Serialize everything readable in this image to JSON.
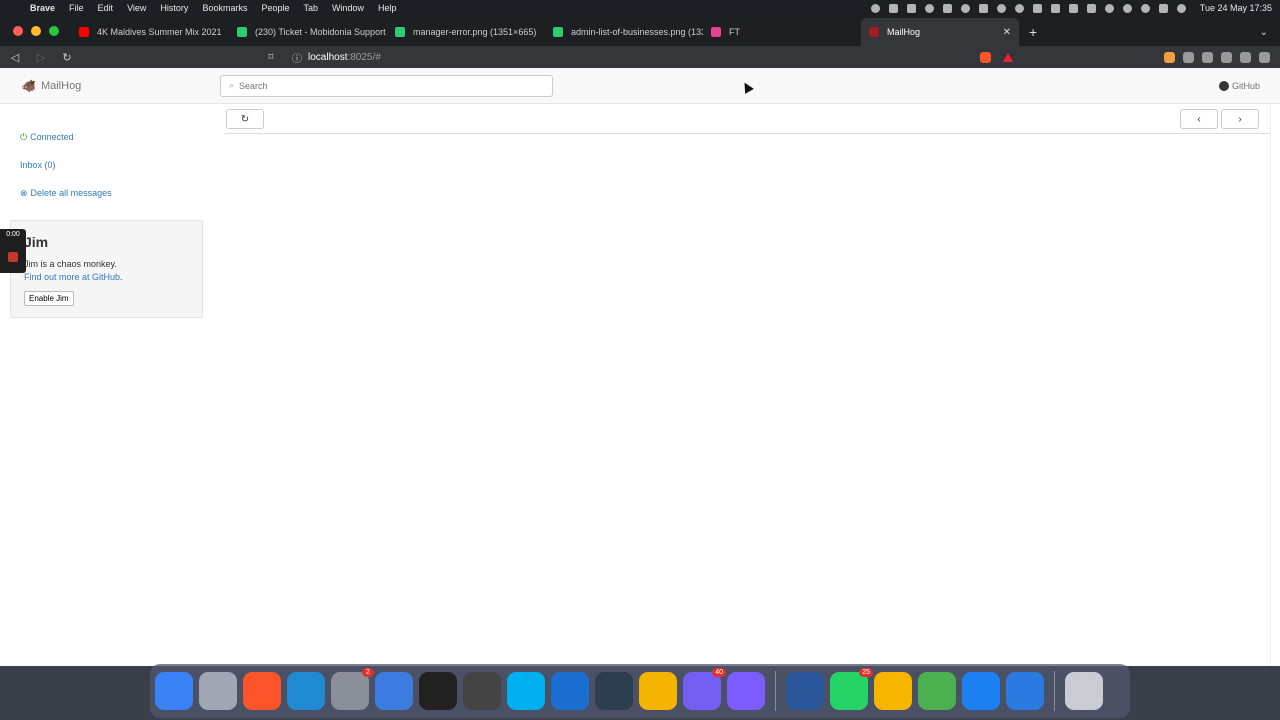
{
  "menubar": {
    "app_name": "Brave",
    "menus": [
      "File",
      "Edit",
      "View",
      "History",
      "Bookmarks",
      "People",
      "Tab",
      "Window",
      "Help"
    ],
    "clock": "Tue 24 May  17:35"
  },
  "browser": {
    "tabs": [
      {
        "title": "4K Maldives Summer Mix 2021",
        "favicon_color": "#ff0000"
      },
      {
        "title": "(230) Ticket - Mobidonia Support",
        "favicon_color": "#2ecc71"
      },
      {
        "title": "manager-error.png (1351×665)",
        "favicon_color": "#2ecc71"
      },
      {
        "title": "admin-list-of-businesses.png (133",
        "favicon_color": "#2ecc71"
      },
      {
        "title": "FT",
        "favicon_color": "#e84393"
      },
      {
        "title": "MailHog",
        "favicon_color": "#a02020",
        "active": true
      }
    ],
    "url_host": "localhost",
    "url_path": ":8025/#"
  },
  "app": {
    "brand": "MailHog",
    "search_placeholder": "Search",
    "github_label": "GitHub",
    "sidebar": {
      "connected": "Connected",
      "inbox": "Inbox (0)",
      "delete_all": "Delete all messages"
    },
    "jim": {
      "title": "Jim",
      "description": "Jim is a chaos monkey.",
      "link": "Find out more at GitHub",
      "link_suffix": ".",
      "button": "Enable Jim"
    }
  },
  "recorder": {
    "time": "0:00"
  },
  "dock": {
    "apps": [
      {
        "name": "finder-icon",
        "color": "#3b82f6"
      },
      {
        "name": "launchpad-icon",
        "color": "#a0a6b4"
      },
      {
        "name": "brave-icon",
        "color": "#fb542b"
      },
      {
        "name": "vscode-icon",
        "color": "#1f8ad2"
      },
      {
        "name": "system-preferences-icon",
        "color": "#8a8f99",
        "badge": "2"
      },
      {
        "name": "spark-icon",
        "color": "#3c7ce0"
      },
      {
        "name": "terminal-icon",
        "color": "#222222"
      },
      {
        "name": "calculator-icon",
        "color": "#444444"
      },
      {
        "name": "skype-icon",
        "color": "#00aff0"
      },
      {
        "name": "1password-icon",
        "color": "#1a6fd1"
      },
      {
        "name": "quicktime-icon",
        "color": "#2c3e50"
      },
      {
        "name": "tableplus-icon",
        "color": "#f4b400"
      },
      {
        "name": "viber-icon",
        "color": "#7360f2",
        "badge": "40"
      },
      {
        "name": "settings-gear-icon",
        "color": "#7b5cff"
      },
      {
        "name": "word-icon",
        "color": "#2b579a"
      },
      {
        "name": "whatsapp-icon",
        "color": "#25d366",
        "badge": "25"
      },
      {
        "name": "sketch-icon",
        "color": "#f7b500"
      },
      {
        "name": "code-editor-icon",
        "color": "#4caf50"
      },
      {
        "name": "xcode-icon",
        "color": "#1c7ff2"
      },
      {
        "name": "onedrive-icon",
        "color": "#2a7ae2"
      },
      {
        "name": "trash-icon",
        "color": "#c9ccd2"
      }
    ]
  }
}
